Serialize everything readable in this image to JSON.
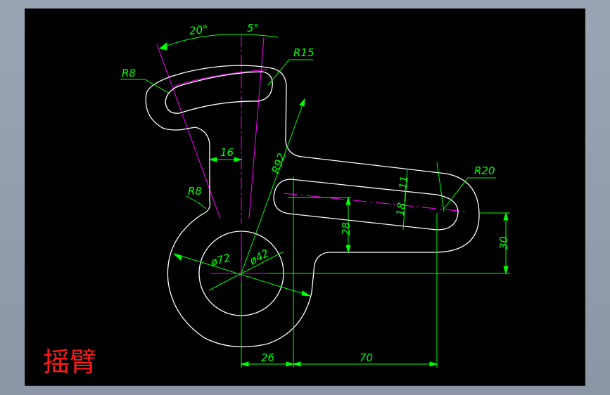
{
  "title": "摇臂",
  "dimensions": {
    "angle_left": "20°",
    "angle_right": "5°",
    "r15": "R15",
    "r8_top": "R8",
    "width_16": "16",
    "r92": "R92",
    "r8_side": "R8",
    "dia72": "ø72",
    "dia42": "ø42",
    "r20": "R20",
    "h11": "11",
    "h18": "18",
    "h28": "28",
    "h30": "30",
    "w26": "26",
    "w70": "70"
  },
  "colors": {
    "background": "#000000",
    "outline": "#ffffff",
    "dimension": "#00ff00",
    "centerline": "#ff00ff",
    "title": "#ff1a1a"
  }
}
